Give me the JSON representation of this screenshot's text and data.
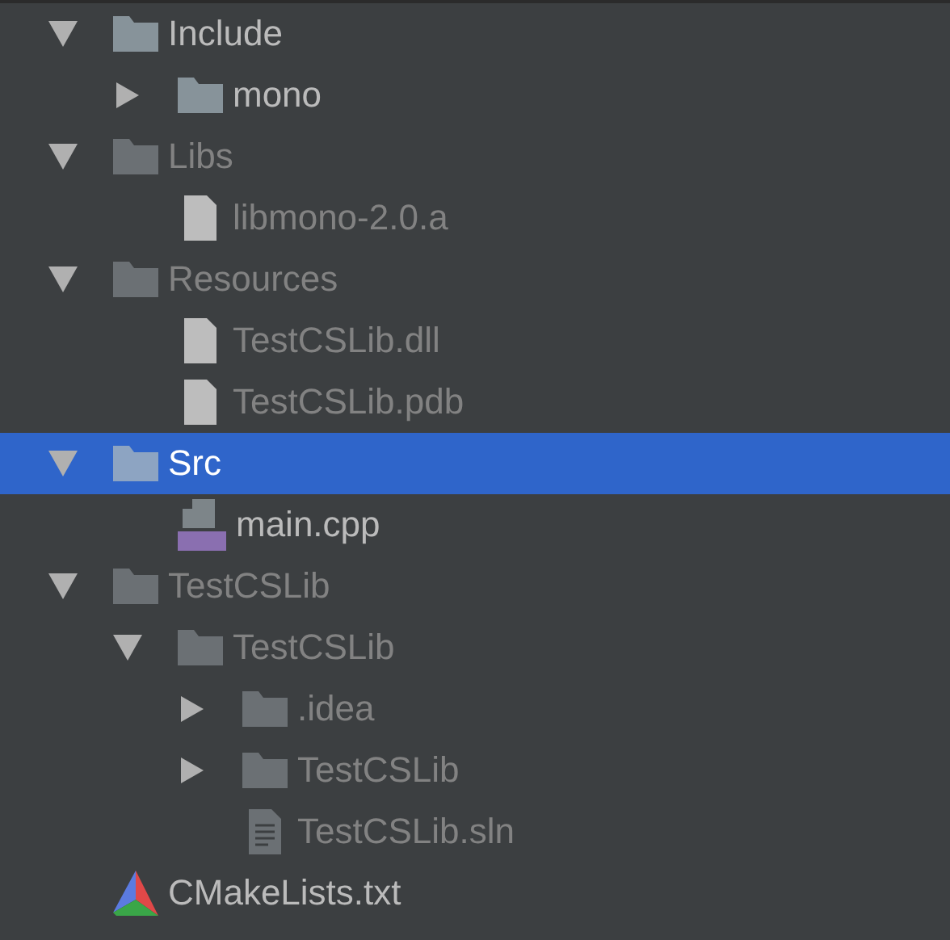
{
  "tree": [
    {
      "label": "Include",
      "kind": "folder",
      "expanded": true,
      "dimmed": false,
      "selected": false,
      "children": [
        {
          "label": "mono",
          "kind": "folder",
          "expanded": false,
          "dimmed": false,
          "selected": false
        }
      ]
    },
    {
      "label": "Libs",
      "kind": "folder",
      "expanded": true,
      "dimmed": true,
      "selected": false,
      "children": [
        {
          "label": "libmono-2.0.a",
          "kind": "file",
          "dimmed": true,
          "selected": false
        }
      ]
    },
    {
      "label": "Resources",
      "kind": "folder",
      "expanded": true,
      "dimmed": true,
      "selected": false,
      "children": [
        {
          "label": "TestCSLib.dll",
          "kind": "file",
          "dimmed": true,
          "selected": false
        },
        {
          "label": "TestCSLib.pdb",
          "kind": "file",
          "dimmed": true,
          "selected": false
        }
      ]
    },
    {
      "label": "Src",
      "kind": "folder",
      "expanded": true,
      "dimmed": false,
      "selected": true,
      "children": [
        {
          "label": "main.cpp",
          "kind": "cpp",
          "dimmed": false,
          "selected": false
        }
      ]
    },
    {
      "label": "TestCSLib",
      "kind": "folder",
      "expanded": true,
      "dimmed": true,
      "selected": false,
      "children": [
        {
          "label": "TestCSLib",
          "kind": "folder",
          "expanded": true,
          "dimmed": true,
          "selected": false,
          "children": [
            {
              "label": ".idea",
              "kind": "folder",
              "expanded": false,
              "dimmed": true,
              "selected": false
            },
            {
              "label": "TestCSLib",
              "kind": "folder",
              "expanded": false,
              "dimmed": true,
              "selected": false
            },
            {
              "label": "TestCSLib.sln",
              "kind": "text",
              "dimmed": true,
              "selected": false
            }
          ]
        }
      ]
    },
    {
      "label": "CMakeLists.txt",
      "kind": "cmake",
      "dimmed": false,
      "selected": false
    }
  ]
}
